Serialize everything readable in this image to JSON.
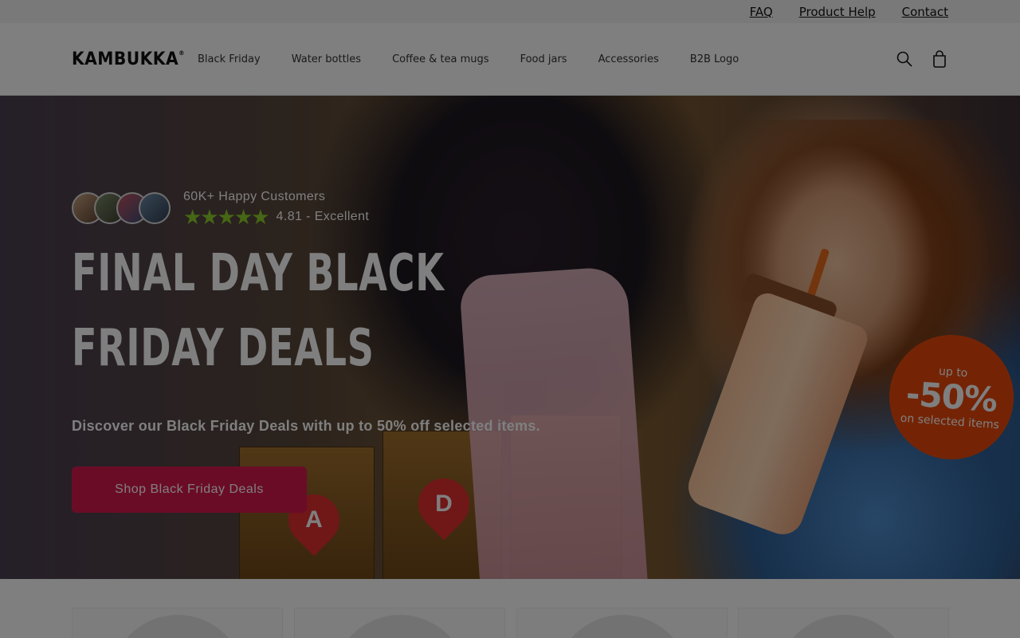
{
  "topbar": {
    "links": [
      {
        "label": "FAQ"
      },
      {
        "label": "Product Help"
      },
      {
        "label": "Contact"
      }
    ]
  },
  "header": {
    "logo": "KAMBUKKA",
    "logo_mark": "®",
    "nav": [
      {
        "label": "Black Friday"
      },
      {
        "label": "Water bottles"
      },
      {
        "label": "Coffee & tea mugs"
      },
      {
        "label": "Food jars"
      },
      {
        "label": "Accessories"
      },
      {
        "label": "B2B Logo"
      }
    ],
    "icons": [
      "search-icon",
      "cart-icon"
    ]
  },
  "hero": {
    "social_proof": {
      "customers": "60K+ Happy Customers",
      "stars": "★★★★★",
      "rating_text": "4.81 - Excellent"
    },
    "headline": "FINAL DAY BLACK FRIDAY DEALS",
    "subtext": "Discover our Black Friday Deals with up to 50% off selected items.",
    "cta_label": "Shop Black Friday Deals",
    "badge": {
      "line1": "up to",
      "line2": "-50%",
      "line3": "on selected items"
    },
    "locker_tags": [
      "A",
      "D"
    ]
  },
  "colors": {
    "cta": "#d6194f",
    "badge": "#e8480a",
    "stars": "#8ccf2a",
    "overlay": "rgba(0,0,0,0.5)"
  }
}
